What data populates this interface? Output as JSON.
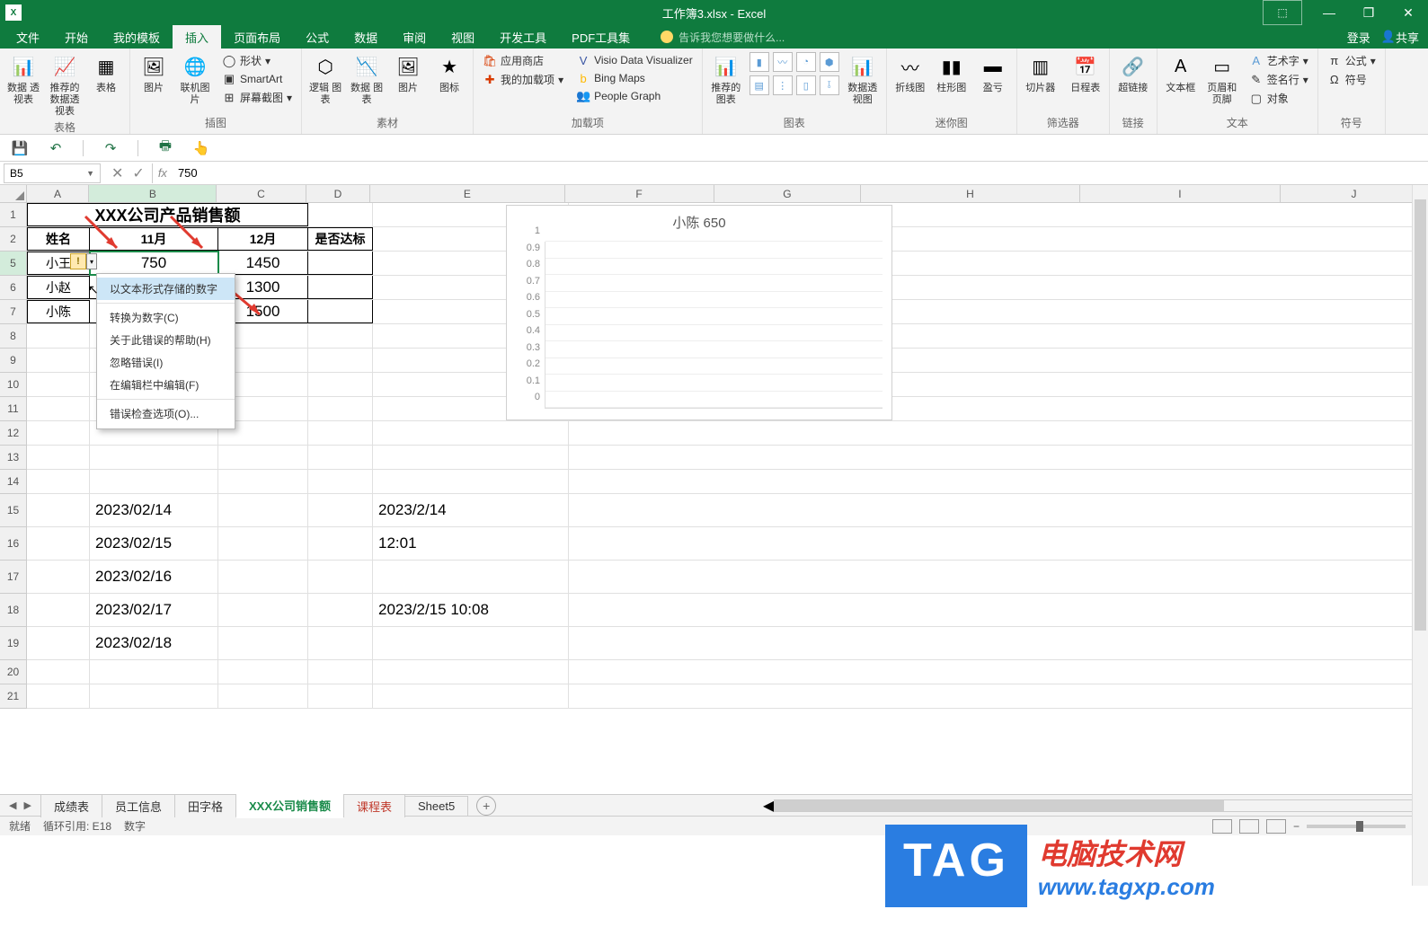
{
  "title_bar": {
    "file_title": "工作簿3.xlsx - Excel"
  },
  "tabs": {
    "file": "文件",
    "home": "开始",
    "templates": "我的模板",
    "insert": "插入",
    "layout": "页面布局",
    "formulas": "公式",
    "data": "数据",
    "review": "审阅",
    "view": "视图",
    "dev": "开发工具",
    "pdf": "PDF工具集",
    "tellme": "告诉我您想要做什么...",
    "login": "登录",
    "share": "共享"
  },
  "ribbon": {
    "tables": {
      "pivot": "数据\n透视表",
      "rec": "推荐的\n数据透视表",
      "table": "表格",
      "group": "表格"
    },
    "illus": {
      "pic": "图片",
      "online": "联机图片",
      "shapes": "形状",
      "smart": "SmartArt",
      "screen": "屏幕截图",
      "group": "插图"
    },
    "material": {
      "logic": "逻辑\n图表",
      "data": "数据\n图表",
      "pic": "图片",
      "icon": "图标",
      "group": "素材"
    },
    "addins": {
      "store": "应用商店",
      "my": "我的加载项",
      "visio": "Visio Data Visualizer",
      "bing": "Bing Maps",
      "people": "People Graph",
      "group": "加载项"
    },
    "charts": {
      "rec": "推荐的\n图表",
      "pivot": "数据透视图",
      "group": "图表"
    },
    "spark": {
      "line": "折线图",
      "col": "柱形图",
      "winloss": "盈亏",
      "group": "迷你图"
    },
    "filters": {
      "slicer": "切片器",
      "timeline": "日程表",
      "group": "筛选器"
    },
    "links": {
      "hyper": "超链接",
      "group": "链接"
    },
    "text": {
      "textbox": "文本框",
      "hf": "页眉和页脚",
      "art": "艺术字",
      "sig": "签名行",
      "obj": "对象",
      "group": "文本"
    },
    "symbols": {
      "eq": "公式",
      "sym": "符号",
      "group": "符号"
    }
  },
  "formula_bar": {
    "name_box": "B5",
    "value": "750"
  },
  "columns": [
    "A",
    "B",
    "C",
    "D",
    "E",
    "F",
    "G",
    "H",
    "I",
    "J"
  ],
  "rows_visible": [
    "1",
    "2",
    "5",
    "6",
    "7",
    "8",
    "9",
    "10",
    "11",
    "12",
    "13",
    "14",
    "15",
    "16",
    "17",
    "18",
    "19",
    "20",
    "21"
  ],
  "table": {
    "title": "XXX公司产品销售额",
    "headers": {
      "name": "姓名",
      "nov": "11月",
      "dec": "12月",
      "pass": "是否达标"
    },
    "r5": {
      "a": "小王",
      "b": "750",
      "c": "1450"
    },
    "r6": {
      "a": "小赵",
      "c": "1300"
    },
    "r7": {
      "a": "小陈",
      "c": "1500"
    }
  },
  "dates": {
    "b15": "2023/02/14",
    "b16": "2023/02/15",
    "b17": "2023/02/16",
    "b18": "2023/02/17",
    "b19": "2023/02/18",
    "e15": "2023/2/14",
    "e16": "12:01",
    "e18": "2023/2/15 10:08"
  },
  "context_menu": {
    "i1": "以文本形式存储的数字",
    "i2": "转换为数字(C)",
    "i3": "关于此错误的帮助(H)",
    "i4": "忽略错误(I)",
    "i5": "在编辑栏中编辑(F)",
    "i6": "错误检查选项(O)..."
  },
  "chart_data": {
    "type": "bar",
    "title": "小陈 650",
    "categories": [],
    "values": [],
    "ylim": [
      0,
      1
    ],
    "yticks": [
      0,
      0.1,
      0.2,
      0.3,
      0.4,
      0.5,
      0.6,
      0.7,
      0.8,
      0.9,
      1
    ]
  },
  "sheets": {
    "s1": "成绩表",
    "s2": "员工信息",
    "s3": "田字格",
    "s4": "XXX公司销售额",
    "s5": "课程表",
    "s6": "Sheet5"
  },
  "status": {
    "ready": "就绪",
    "circ": "循环引用: E18",
    "mode": "数字"
  },
  "watermark": {
    "tag": "TAG",
    "l1": "电脑技术网",
    "l2": "www.tagxp.com"
  }
}
